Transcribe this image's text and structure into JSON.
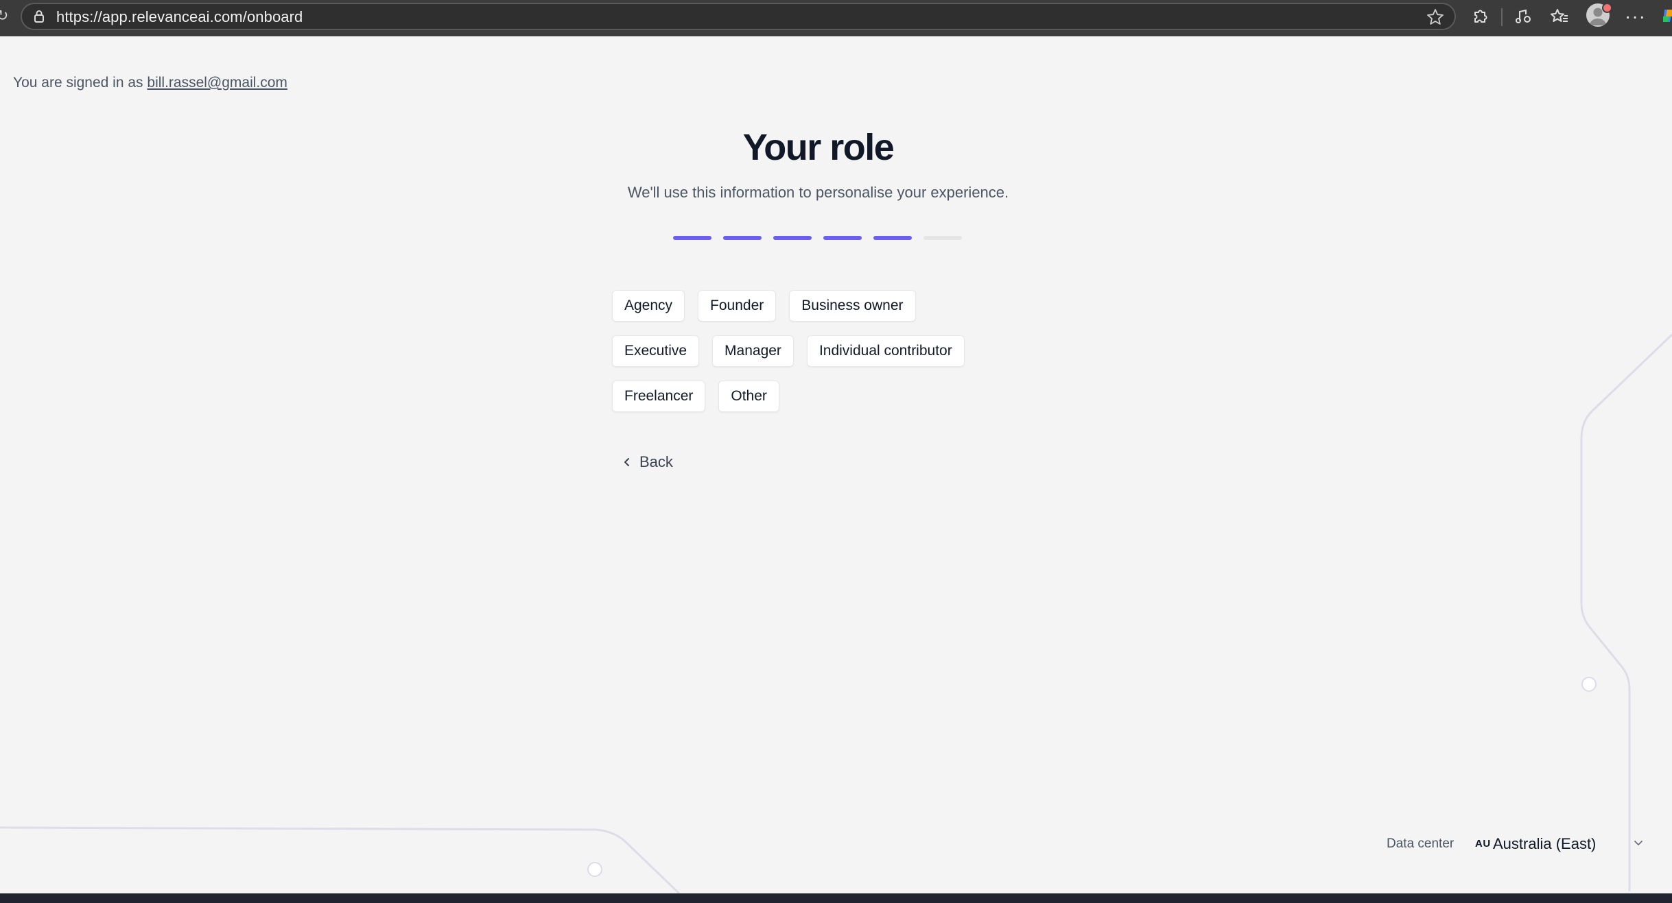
{
  "browser": {
    "url": "https://app.relevanceai.com/onboard"
  },
  "account": {
    "signed_in_prefix": "You are signed in as",
    "email": "bill.rassel@gmail.com"
  },
  "onboarding": {
    "title": "Your role",
    "subtitle": "We'll use this information to personalise your experience.",
    "progress": {
      "completed_steps": 5,
      "total_steps": 6
    },
    "roles": [
      [
        "Agency",
        "Founder",
        "Business owner"
      ],
      [
        "Executive",
        "Manager",
        "Individual contributor"
      ],
      [
        "Freelancer",
        "Other"
      ]
    ],
    "back_label": "Back"
  },
  "datacenter": {
    "label": "Data center",
    "region_code": "AU",
    "region_name": "Australia (East)"
  },
  "colors": {
    "accent": "#6d5ef2",
    "background": "#f4f4f4",
    "browser_bar": "#3b3b3b"
  },
  "icons": [
    "reload-icon",
    "lock-icon",
    "favorite-star-icon",
    "extensions-icon",
    "media-icon",
    "favorites-icon",
    "profile-avatar",
    "more-icon",
    "copilot-icon",
    "chevron-left-icon",
    "chevron-down-icon"
  ]
}
